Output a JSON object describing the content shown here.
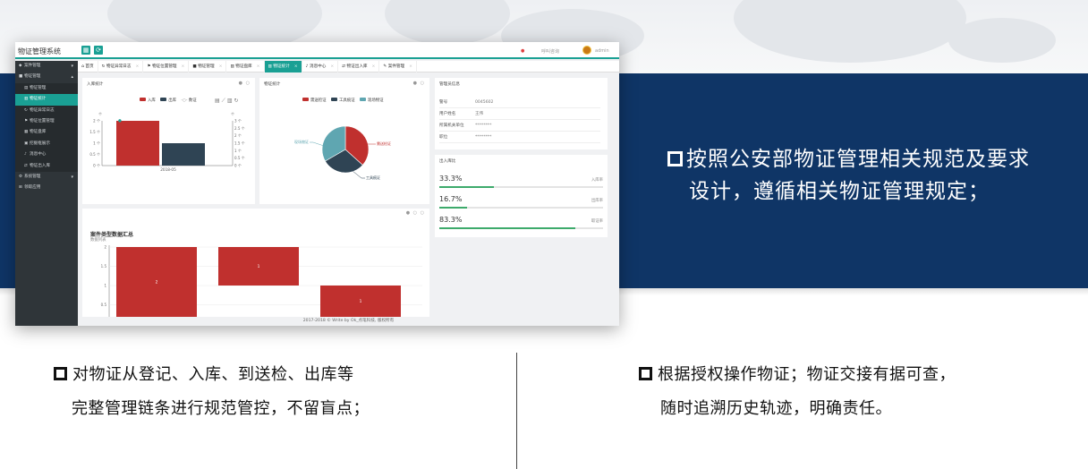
{
  "slide": {
    "points": {
      "right_top": [
        "按照公安部物证管理相关规范及要求",
        "设计，遵循相关物证管理规定；"
      ],
      "bottom_left": [
        "对物证从登记、入库、到送检、出库等",
        "完整管理链条进行规范管控，不留盲点；"
      ],
      "bottom_right": [
        "根据授权操作物证；物证交接有据可查，",
        "随时追溯历史轨迹，明确责任。"
      ]
    },
    "colors": {
      "navy": "#0f3566",
      "accent": "#1aa094",
      "red": "#c0302e",
      "dark": "#2f4454",
      "teal": "#5fa6b1",
      "green": "#3daa6b"
    }
  },
  "app": {
    "title": "物证管理系统",
    "topbar": {
      "btn1_icon": "grid-icon",
      "btn2_icon": "refresh-icon",
      "notice_text": "呼叫咨询",
      "user": "admin"
    },
    "sidebar": [
      {
        "label": "案件管理",
        "icon": "case-icon",
        "type": "group",
        "caret": "▾"
      },
      {
        "label": "物证管理",
        "icon": "evidence-icon",
        "type": "group-open",
        "caret": "▴"
      },
      {
        "label": "物证管理",
        "icon": "list-icon",
        "type": "sub"
      },
      {
        "label": "物证统计",
        "icon": "chart-icon",
        "type": "sub-active"
      },
      {
        "label": "物证异常日志",
        "icon": "log-icon",
        "type": "sub"
      },
      {
        "label": "物证位置管理",
        "icon": "location-icon",
        "type": "sub"
      },
      {
        "label": "物证盘库",
        "icon": "inventory-icon",
        "type": "sub"
      },
      {
        "label": "挖掘框展示",
        "icon": "display-icon",
        "type": "sub"
      },
      {
        "label": "消息中心",
        "icon": "bell-icon",
        "type": "sub"
      },
      {
        "label": "物证出入库",
        "icon": "transfer-icon",
        "type": "sub"
      },
      {
        "label": "系统管理",
        "icon": "settings-icon",
        "type": "group",
        "caret": "▾"
      },
      {
        "label": "领取应用",
        "icon": "apps-icon",
        "type": "group"
      }
    ],
    "tabs": [
      "首页",
      "物证异常日志",
      "物证位置管理",
      "物证管理",
      "物证盘库",
      "物证统计",
      "消息中心",
      "物证出入库",
      "案件管理"
    ],
    "active_tab": 5,
    "footer": "2017-2018 © Write by Ok_点笔科技, 版权所有"
  },
  "panels": {
    "inout": {
      "title": "入库统计",
      "legend": [
        "入库",
        "出库",
        "数证"
      ],
      "tool_icons": [
        "data-view-icon",
        "line-icon",
        "bar-icon",
        "restore-icon"
      ],
      "left_axis": [
        "2 个",
        "1.5 个",
        "1 个",
        "0.5 个",
        "0 个"
      ],
      "right_axis": [
        "3 个",
        "2.5 个",
        "2 个",
        "1.5 个",
        "1 个",
        "0.5 个",
        "0 个"
      ],
      "left_unit": "个",
      "right_unit": "个"
    },
    "pie": {
      "title": "物证统计",
      "legend": [
        "需送检证",
        "工具痕证",
        "现场物证"
      ],
      "labels": [
        "现场物证",
        "需送检证",
        "工具痕证"
      ]
    },
    "waterfall": {
      "title": "案件类型数据汇总",
      "subtitle": "数据列表"
    },
    "admin_info": {
      "title": "管理员信息",
      "rows": [
        {
          "k": "警号",
          "v": "0045602"
        },
        {
          "k": "用户姓名",
          "v": "王伟"
        },
        {
          "k": "所属机关单位",
          "v": "********"
        },
        {
          "k": "职位",
          "v": "********"
        }
      ]
    },
    "ratios": {
      "title": "出入库比",
      "items": [
        {
          "pct": "33.3%",
          "label": "入库率",
          "value": 0.333
        },
        {
          "pct": "16.7%",
          "label": "出库率",
          "value": 0.167
        },
        {
          "pct": "83.3%",
          "label": "取证率",
          "value": 0.833
        }
      ]
    }
  },
  "chart_data": [
    {
      "type": "bar",
      "title": "入库统计",
      "categories": [
        "2018-05"
      ],
      "series": [
        {
          "name": "入库",
          "values": [
            2
          ]
        },
        {
          "name": "出库",
          "values": [
            1
          ]
        }
      ],
      "ylim": [
        0,
        2
      ],
      "y_ticks": [
        0,
        0.5,
        1,
        1.5,
        2
      ],
      "y2lim": [
        0,
        3
      ],
      "y2_ticks": [
        0,
        0.5,
        1,
        1.5,
        2,
        2.5,
        3
      ],
      "legend": "top"
    },
    {
      "type": "pie",
      "title": "物证统计",
      "categories": [
        "需送检证",
        "工具痕证",
        "现场物证"
      ],
      "values": [
        3.3,
        2.7,
        3.0
      ],
      "legend": "top"
    },
    {
      "type": "bar",
      "title": "案件类型数据汇总",
      "subtitle": "数据列表",
      "bars": [
        {
          "base": 0,
          "top": 2,
          "label": "2"
        },
        {
          "base": 1,
          "top": 2,
          "label": "1"
        },
        {
          "base": 0,
          "top": 1,
          "label": "1"
        }
      ],
      "ylim": [
        0,
        2
      ],
      "y_ticks": [
        0.5,
        1,
        1.5,
        2
      ],
      "grid": true
    }
  ]
}
